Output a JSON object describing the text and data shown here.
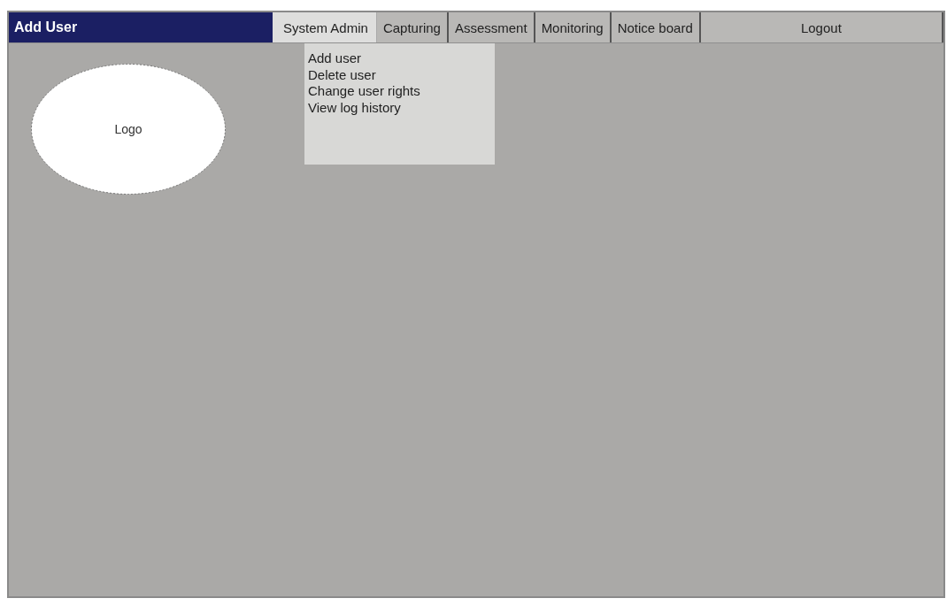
{
  "window": {
    "title": "Add User"
  },
  "tabs": [
    {
      "label": "System Admin",
      "selected": true
    },
    {
      "label": "Capturing",
      "selected": false
    },
    {
      "label": "Assessment",
      "selected": false
    },
    {
      "label": "Monitoring",
      "selected": false
    },
    {
      "label": "Notice board",
      "selected": false
    },
    {
      "label": "Logout",
      "selected": false
    }
  ],
  "menu": {
    "items": [
      "Add user",
      "Delete user",
      "Change user rights",
      "View log history"
    ]
  },
  "logo": {
    "label": "Logo"
  }
}
